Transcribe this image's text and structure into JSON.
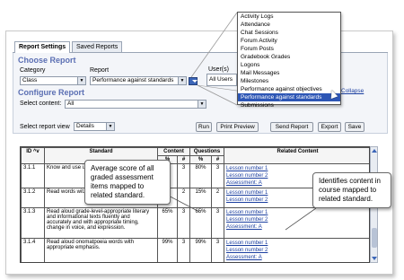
{
  "tabs": [
    {
      "label": "Report Settings",
      "active": true
    },
    {
      "label": "Saved Reports",
      "active": false
    }
  ],
  "choose_report": {
    "title": "Choose Report",
    "category_label": "Category",
    "category_value": "Class",
    "report_label": "Report",
    "report_value": "Performance against standards",
    "users_label": "User(s)",
    "users_value": "All Users"
  },
  "report_menu": {
    "options": [
      "Activity Logs",
      "Attendance",
      "Chat Sessions",
      "Forum Activity",
      "Forum Posts",
      "Gradebook Grades",
      "Logons",
      "Mail Messages",
      "Milestones",
      "Performance against objectives",
      "Performance against standards",
      "Submissions"
    ],
    "selected": "Performance against standards"
  },
  "collapse_label": "Collapse",
  "configure_report": {
    "title": "Configure Report",
    "content_label": "Select content:",
    "content_value": "All"
  },
  "view": {
    "label": "Select report view",
    "value": "Details"
  },
  "actions": {
    "run": "Run",
    "print": "Print Preview",
    "send": "Send Report",
    "export": "Export",
    "save": "Save"
  },
  "table": {
    "headers": {
      "id": "ID ^v",
      "standard": "Standard",
      "content": "Content",
      "questions": "Questions",
      "related": "Related Content"
    },
    "subheaders": [
      "%",
      "#",
      "%",
      "#"
    ],
    "rows": [
      {
        "id": "3.1.1",
        "standard": "Know and use i... ight) when readi...",
        "c_pct": "",
        "c_num": "3",
        "q_pct": "80%",
        "q_num": "3",
        "links": [
          "Lesson number 1",
          "Lesson number 2",
          "Assessment: A"
        ]
      },
      {
        "id": "3.1.2",
        "standard": "Read words wit...",
        "c_pct": "",
        "c_num": "2",
        "q_pct": "15%",
        "q_num": "2",
        "links": [
          "Lesson number 1",
          "Lesson number 2"
        ]
      },
      {
        "id": "3.1.3",
        "standard": "Read aloud grade-level-appropriate literary and informational texts fluently and accurately and with appropriate timing, change in voice, and expression.",
        "c_pct": "65%",
        "c_num": "3",
        "q_pct": "65%",
        "q_num": "3",
        "links": [
          "Lesson number 1",
          "Lesson number 2",
          "Assessment: A"
        ]
      },
      {
        "id": "3.1.4",
        "standard": "Read aloud onomatpoeia words with appropriate emphasis.",
        "c_pct": "99%",
        "c_num": "3",
        "q_pct": "99%",
        "q_num": "3",
        "links": [
          "Lesson number 1",
          "Lesson number 2",
          "Assessment: A"
        ]
      }
    ]
  },
  "callouts": {
    "left": "Average score of all graded assessment items mapped to related standard.",
    "right": "Identifies content in course mapped to related standard."
  }
}
